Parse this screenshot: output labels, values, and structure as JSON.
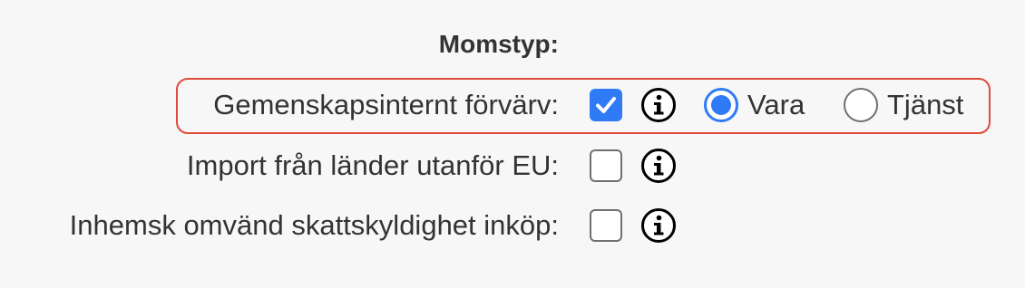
{
  "section": {
    "title": "Momstyp:"
  },
  "colors": {
    "accent": "#2f7bf5",
    "highlight": "#e04a3a",
    "text": "#333333"
  },
  "rows": [
    {
      "label": "Gemenskapsinternt förvärv:",
      "checked": true,
      "info_icon": "info-circle-icon",
      "highlighted": true,
      "radio_options": [
        {
          "label": "Vara",
          "selected": true
        },
        {
          "label": "Tjänst",
          "selected": false
        }
      ]
    },
    {
      "label": "Import från länder utanför EU:",
      "checked": false,
      "info_icon": "info-circle-icon"
    },
    {
      "label": "Inhemsk omvänd skattskyldighet inköp:",
      "checked": false,
      "info_icon": "info-circle-icon"
    }
  ]
}
